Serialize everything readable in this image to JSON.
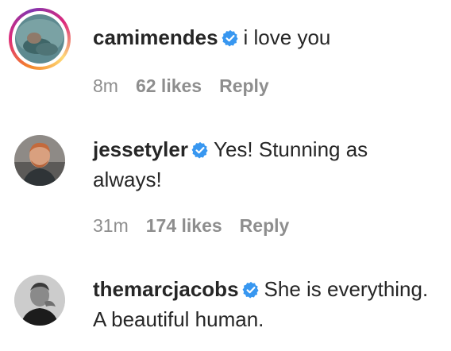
{
  "comments": [
    {
      "username": "camimendes",
      "verified": true,
      "has_story_ring": true,
      "text": "i love you",
      "time": "8m",
      "likes": "62 likes",
      "reply_label": "Reply"
    },
    {
      "username": "jessetyler",
      "verified": true,
      "has_story_ring": false,
      "text": "Yes! Stunning as always!",
      "time": "31m",
      "likes": "174 likes",
      "reply_label": "Reply"
    },
    {
      "username": "themarcjacobs",
      "verified": true,
      "has_story_ring": false,
      "text": "She is everything. A beautiful human."
    }
  ],
  "colors": {
    "text": "#262626",
    "meta": "#8e8e8e",
    "verified_badge": "#3897f0"
  },
  "icons": {
    "verified": "verified-badge-icon"
  }
}
